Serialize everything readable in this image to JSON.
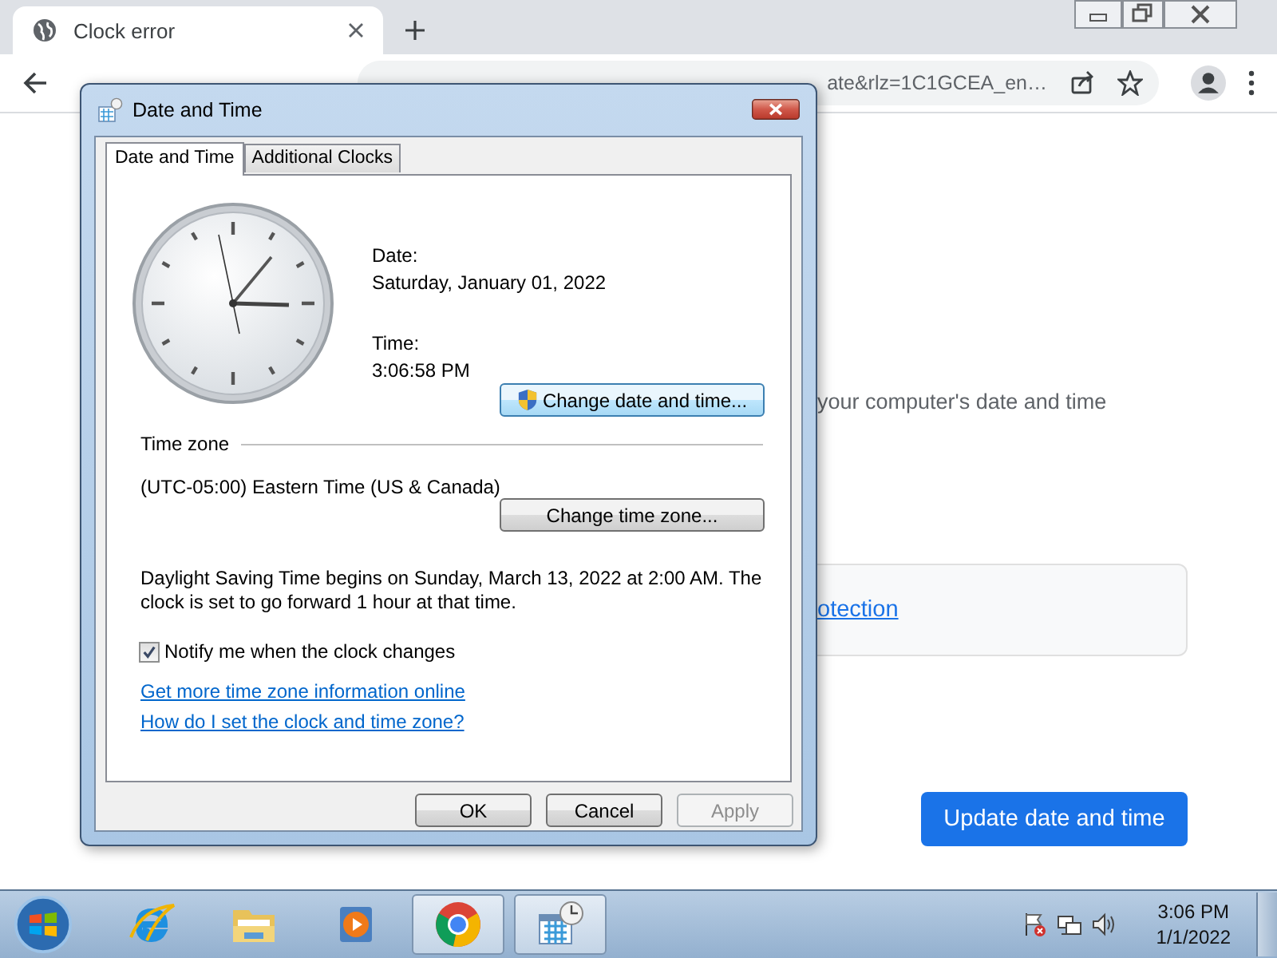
{
  "browser": {
    "tabs": [
      {
        "title": "Clock error",
        "selected": true
      }
    ],
    "address": {
      "url": "ate&rlz=1C1GCEA_en…"
    }
  },
  "page": {
    "description": "your computer's date and time",
    "link": "otection",
    "button": "Update date and time"
  },
  "dialog": {
    "title": "Date and Time",
    "tabs": [
      {
        "label": "Date and Time",
        "selected": true
      },
      {
        "label": "Additional Clocks",
        "selected": false
      }
    ],
    "date_label": "Date:",
    "date": "Saturday, January 01, 2022",
    "time_label": "Time:",
    "time": "3:06:58 PM",
    "change_datetime": "Change date and time...",
    "time_zone_heading": "Time zone",
    "time_zone": "(UTC-05:00) Eastern Time (US & Canada)",
    "change_timezone": "Change time zone...",
    "dst_note": "Daylight Saving Time begins on Sunday, March 13, 2022 at 2:00 AM. The clock is set to go forward 1 hour at that time.",
    "notify": {
      "label": "Notify me when the clock changes",
      "checked": true
    },
    "links": [
      "Get more time zone information online",
      "How do I set the clock and time zone?"
    ],
    "buttons": [
      {
        "label": "OK",
        "disabled": false
      },
      {
        "label": "Cancel",
        "disabled": false
      },
      {
        "label": "Apply",
        "disabled": true
      }
    ]
  },
  "taskbar": {
    "apps": [
      {
        "kind": "ie",
        "active": false
      },
      {
        "kind": "folder",
        "active": false
      },
      {
        "kind": "media",
        "active": false
      },
      {
        "kind": "chrome",
        "active": true
      },
      {
        "kind": "calendar",
        "active": true
      }
    ],
    "time": "3:06 PM",
    "date": "1/1/2022"
  }
}
